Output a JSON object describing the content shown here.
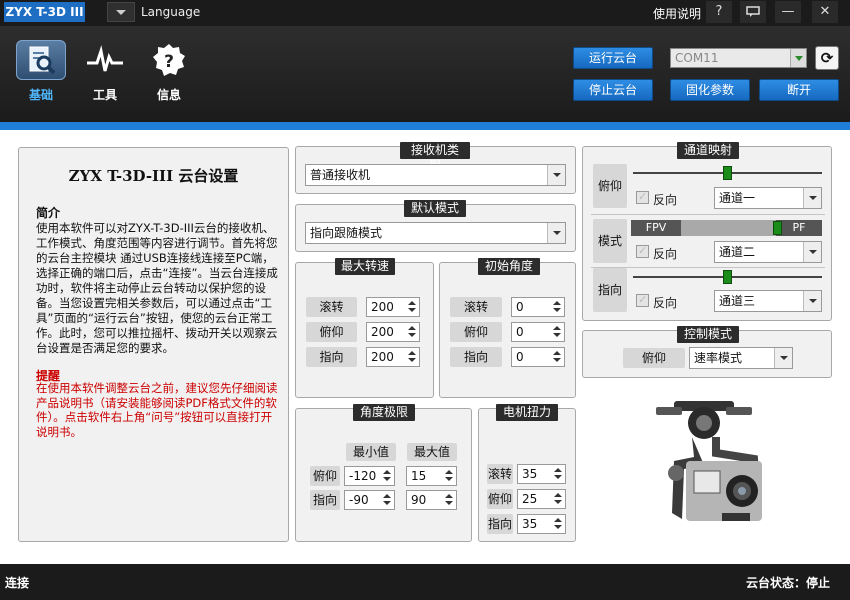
{
  "window": {
    "app_title": "ZYX T-3D III",
    "language_label": "Language",
    "help_label": "使用说明",
    "help_icon": "?",
    "chat_icon": "chat-icon",
    "minimize_icon": "—",
    "close_icon": "✕"
  },
  "nav": [
    {
      "label": "基础",
      "icon": "magnifier-document-icon",
      "active": true
    },
    {
      "label": "工具",
      "icon": "pulse-icon",
      "active": false
    },
    {
      "label": "信息",
      "icon": "info-badge-icon",
      "active": false
    }
  ],
  "toolbar": {
    "run_gimbal": "运行云台",
    "stop_gimbal": "停止云台",
    "com_port": "COM11",
    "refresh_icon": "⟳",
    "firmware_params": "固化参数",
    "disconnect": "断开"
  },
  "intro": {
    "title": "ZYX T-3D-III 云台设置",
    "heading": "简介",
    "body": "使用本软件可以对ZYX-T-3D-III云台的接收机、工作模式、角度范围等内容进行调节。首先将您的云台主控模块 通过USB连接线连接至PC端，选择正确的端口后，点击“连接”。当云台连接成功时，软件将主动停止云台转动以保护您的设备。当您设置完相关参数后，可以通过点击“工具”页面的“运行云台”按钮，使您的云台正常工作。此时，您可以推拉摇杆、拨动开关以观察云台设置是否满足您的要求。",
    "tip_heading": "提醒",
    "tip_body": "在使用本软件调整云台之前，建议您先仔细阅读产品说明书（请安装能够阅读PDF格式文件的软件）。点击软件右上角“问号”按钮可以直接打开说明书。"
  },
  "receiver": {
    "title": "接收机类型",
    "value": "普通接收机"
  },
  "default_mode": {
    "title": "默认模式",
    "value": "指向跟随模式"
  },
  "max_speed": {
    "title": "最大转速",
    "rows": [
      {
        "label": "滚转",
        "value": "200"
      },
      {
        "label": "俯仰",
        "value": "200"
      },
      {
        "label": "指向",
        "value": "200"
      }
    ]
  },
  "init_angle": {
    "title": "初始角度",
    "rows": [
      {
        "label": "滚转",
        "value": "0"
      },
      {
        "label": "俯仰",
        "value": "0"
      },
      {
        "label": "指向",
        "value": "0"
      }
    ]
  },
  "angle_limit": {
    "title": "角度极限",
    "min_header": "最小值",
    "max_header": "最大值",
    "rows": [
      {
        "label": "俯仰",
        "min": "-120",
        "max": "15"
      },
      {
        "label": "指向",
        "min": "-90",
        "max": "90"
      }
    ]
  },
  "motor_torque": {
    "title": "电机扭力",
    "rows": [
      {
        "label": "滚转",
        "value": "35"
      },
      {
        "label": "俯仰",
        "value": "25"
      },
      {
        "label": "指向",
        "value": "35"
      }
    ]
  },
  "channel_map": {
    "title": "通道映射",
    "reverse_label": "反向",
    "rows": [
      {
        "label": "俯仰",
        "channel": "通道一",
        "slider_fraction": 0.5
      },
      {
        "label": "模式",
        "channel": "通道二",
        "mode_left": "FPV",
        "mode_right": "PF",
        "slider_fraction": 0.77
      },
      {
        "label": "指向",
        "channel": "通道三",
        "slider_fraction": 0.5
      }
    ]
  },
  "control_mode": {
    "title": "控制模式",
    "axis_label": "俯仰",
    "value": "速率模式"
  },
  "status": {
    "left": "连接",
    "right": "云台状态：停止"
  },
  "colors": {
    "accent_blue": "#1e7ed8",
    "slider_green": "#1a8c1a",
    "tip_red": "#cc0000"
  }
}
